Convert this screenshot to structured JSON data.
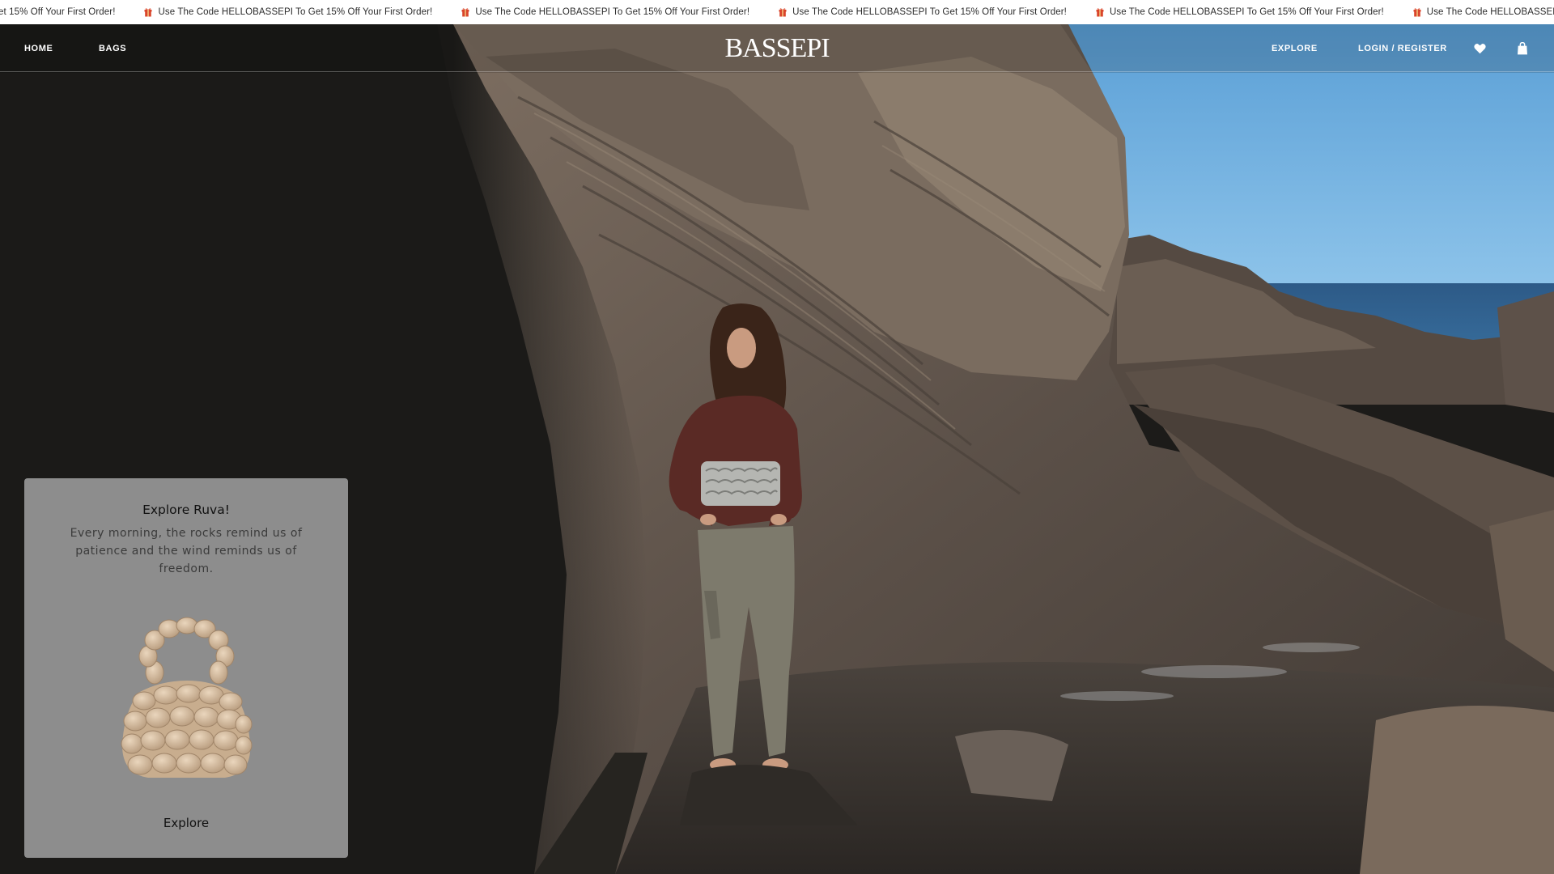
{
  "announcement": {
    "first_fragment": "et 15% Off Your First Order!",
    "message": "Use The Code HELLOBASSEPI To Get 15% Off Your First Order!",
    "repeat_count": 5,
    "gift_icon": "gift-icon",
    "gift_color": "#d9452b"
  },
  "header": {
    "nav_left": [
      "HOME",
      "BAGS"
    ],
    "logo": "BASSEPI",
    "nav_right": {
      "explore": "EXPLORE",
      "login": "LOGIN / REGISTER"
    },
    "icons": [
      "heart-icon",
      "shopping-bag-icon"
    ]
  },
  "promo_card": {
    "title": "Explore Ruva!",
    "description": "Every morning, the rocks remind us of patience and the wind reminds us of freedom.",
    "cta": "Explore",
    "background": "#8d8d8d"
  },
  "colors": {
    "sky": "#6aaad9",
    "sea": "#2f5f8f",
    "rock": "#6b5d50",
    "shadow": "#1f1e1c"
  }
}
